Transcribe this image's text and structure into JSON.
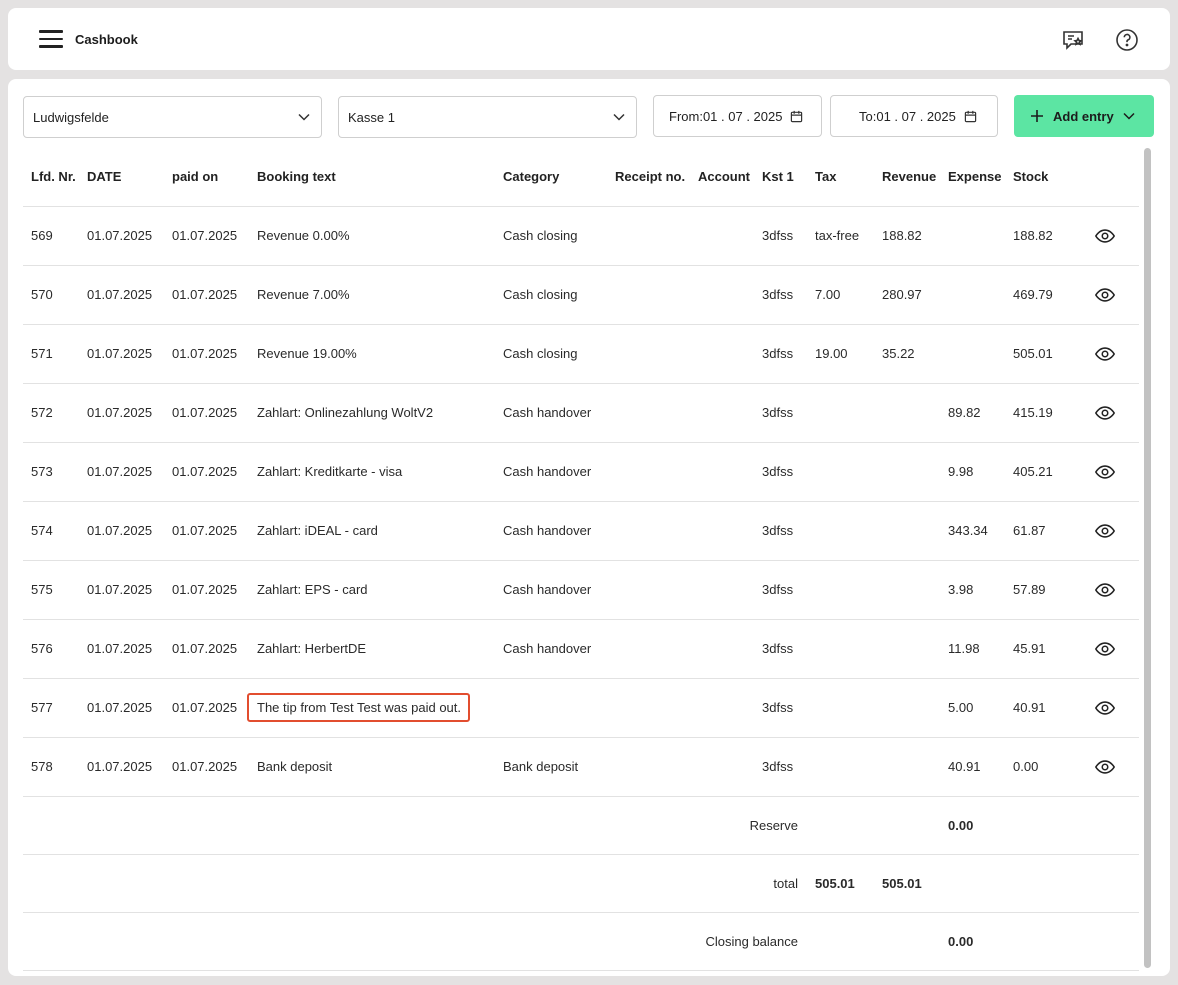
{
  "header": {
    "title": "Cashbook",
    "menu_icon": "hamburger-menu-icon",
    "feedback_icon": "chat-star-icon",
    "help_icon": "help-circle-icon"
  },
  "filters": {
    "location": "Ludwigsfelde",
    "register": "Kasse 1",
    "from_label": "From:",
    "from_date": "01 . 07 . 2025",
    "to_label": "To:",
    "to_date": "01 . 07 . 2025",
    "add_entry": "Add entry"
  },
  "colors": {
    "accent": "#5ce5a3",
    "highlight_border": "#e24d2f"
  },
  "table": {
    "columns": [
      "Lfd. Nr.",
      "DATE",
      "paid on",
      "Booking text",
      "Category",
      "Receipt no.",
      "Account",
      "Kst 1",
      "Tax",
      "Revenue",
      "Expense",
      "Stock"
    ],
    "rows": [
      {
        "nr": "569",
        "date": "01.07.2025",
        "paid_on": "01.07.2025",
        "text": "Revenue 0.00%",
        "category": "Cash closing",
        "receipt": "",
        "account": "",
        "kst": "3dfss",
        "tax": "tax-free",
        "revenue": "188.82",
        "expense": "",
        "stock": "188.82"
      },
      {
        "nr": "570",
        "date": "01.07.2025",
        "paid_on": "01.07.2025",
        "text": "Revenue 7.00%",
        "category": "Cash closing",
        "receipt": "",
        "account": "",
        "kst": "3dfss",
        "tax": "7.00",
        "revenue": "280.97",
        "expense": "",
        "stock": "469.79"
      },
      {
        "nr": "571",
        "date": "01.07.2025",
        "paid_on": "01.07.2025",
        "text": "Revenue 19.00%",
        "category": "Cash closing",
        "receipt": "",
        "account": "",
        "kst": "3dfss",
        "tax": "19.00",
        "revenue": "35.22",
        "expense": "",
        "stock": "505.01"
      },
      {
        "nr": "572",
        "date": "01.07.2025",
        "paid_on": "01.07.2025",
        "text": "Zahlart: Onlinezahlung WoltV2",
        "category": "Cash handover",
        "receipt": "",
        "account": "",
        "kst": "3dfss",
        "tax": "",
        "revenue": "",
        "expense": "89.82",
        "stock": "415.19"
      },
      {
        "nr": "573",
        "date": "01.07.2025",
        "paid_on": "01.07.2025",
        "text": "Zahlart: Kreditkarte - visa",
        "category": "Cash handover",
        "receipt": "",
        "account": "",
        "kst": "3dfss",
        "tax": "",
        "revenue": "",
        "expense": "9.98",
        "stock": "405.21"
      },
      {
        "nr": "574",
        "date": "01.07.2025",
        "paid_on": "01.07.2025",
        "text": "Zahlart: iDEAL - card",
        "category": "Cash handover",
        "receipt": "",
        "account": "",
        "kst": "3dfss",
        "tax": "",
        "revenue": "",
        "expense": "343.34",
        "stock": "61.87"
      },
      {
        "nr": "575",
        "date": "01.07.2025",
        "paid_on": "01.07.2025",
        "text": "Zahlart: EPS - card",
        "category": "Cash handover",
        "receipt": "",
        "account": "",
        "kst": "3dfss",
        "tax": "",
        "revenue": "",
        "expense": "3.98",
        "stock": "57.89"
      },
      {
        "nr": "576",
        "date": "01.07.2025",
        "paid_on": "01.07.2025",
        "text": "Zahlart: HerbertDE",
        "category": "Cash handover",
        "receipt": "",
        "account": "",
        "kst": "3dfss",
        "tax": "",
        "revenue": "",
        "expense": "11.98",
        "stock": "45.91"
      },
      {
        "nr": "577",
        "date": "01.07.2025",
        "paid_on": "01.07.2025",
        "text": "The tip from Test Test was paid out.",
        "category": "",
        "receipt": "",
        "account": "",
        "kst": "3dfss",
        "tax": "",
        "revenue": "",
        "expense": "5.00",
        "stock": "40.91",
        "highlighted": true
      },
      {
        "nr": "578",
        "date": "01.07.2025",
        "paid_on": "01.07.2025",
        "text": "Bank deposit",
        "category": "Bank deposit",
        "receipt": "",
        "account": "",
        "kst": "3dfss",
        "tax": "",
        "revenue": "",
        "expense": "40.91",
        "stock": "0.00"
      }
    ],
    "summary": {
      "reserve_label": "Reserve",
      "reserve_value": "0.00",
      "total_label": "total",
      "total_tax": "505.01",
      "total_revenue": "505.01",
      "closing_label": "Closing balance",
      "closing_value": "0.00"
    }
  }
}
